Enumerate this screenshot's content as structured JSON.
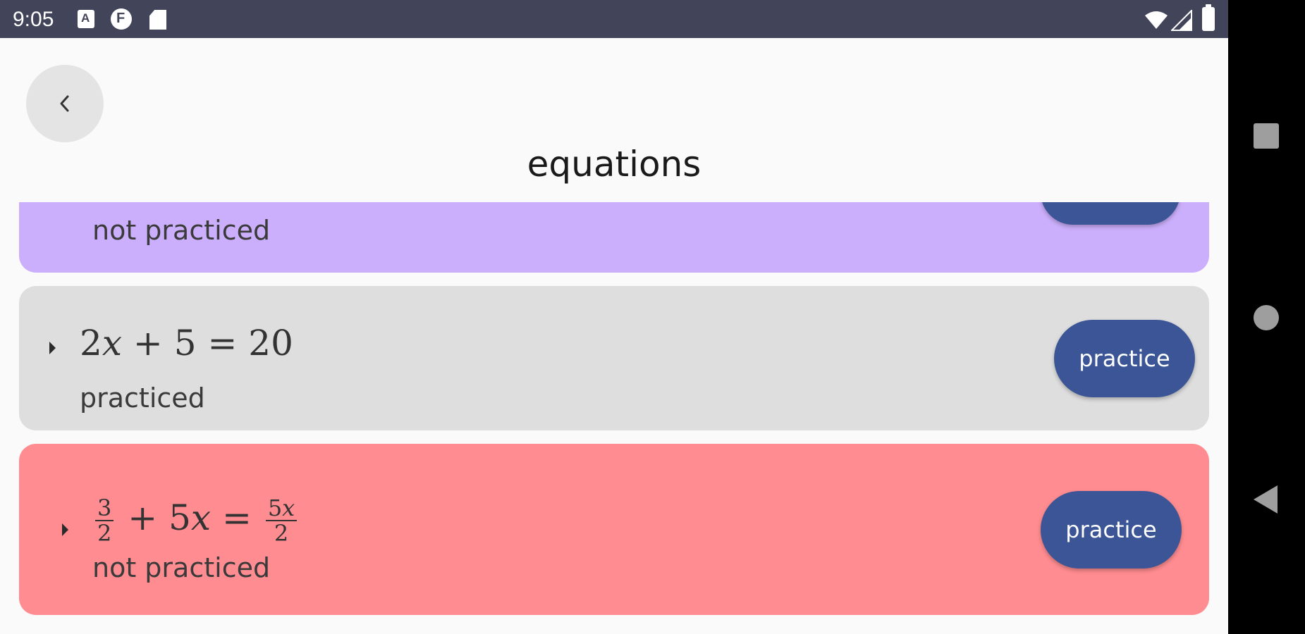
{
  "status_bar": {
    "time": "9:05",
    "icons": [
      "notification-a-icon",
      "notification-f-icon",
      "sd-card-icon",
      "wifi-icon",
      "signal-icon",
      "battery-icon"
    ]
  },
  "header": {
    "title": "equations",
    "back_icon": "chevron-left-icon"
  },
  "cards": [
    {
      "equation_text": "",
      "status": "not practiced",
      "button_label": "",
      "color": "#cbaffc"
    },
    {
      "equation": {
        "lhs_coef": "2",
        "var": "x",
        "plus": "+",
        "const": "5",
        "eq": "=",
        "rhs": "20"
      },
      "status": "practiced",
      "button_label": "practice",
      "color": "#dedede"
    },
    {
      "equation": {
        "frac1_num": "3",
        "frac1_den": "2",
        "plus": "+",
        "coef": "5",
        "var": "x",
        "eq": "=",
        "frac2_num_coef": "5",
        "frac2_num_var": "x",
        "frac2_den": "2"
      },
      "status": "not practiced",
      "button_label": "practice",
      "color": "#ff8c90"
    }
  ],
  "colors": {
    "button": "#3b5597",
    "status_bar": "#42445a",
    "background": "#fafafa"
  },
  "nav_bar": {
    "icons": [
      "recent-apps-icon",
      "home-icon",
      "back-icon"
    ]
  }
}
